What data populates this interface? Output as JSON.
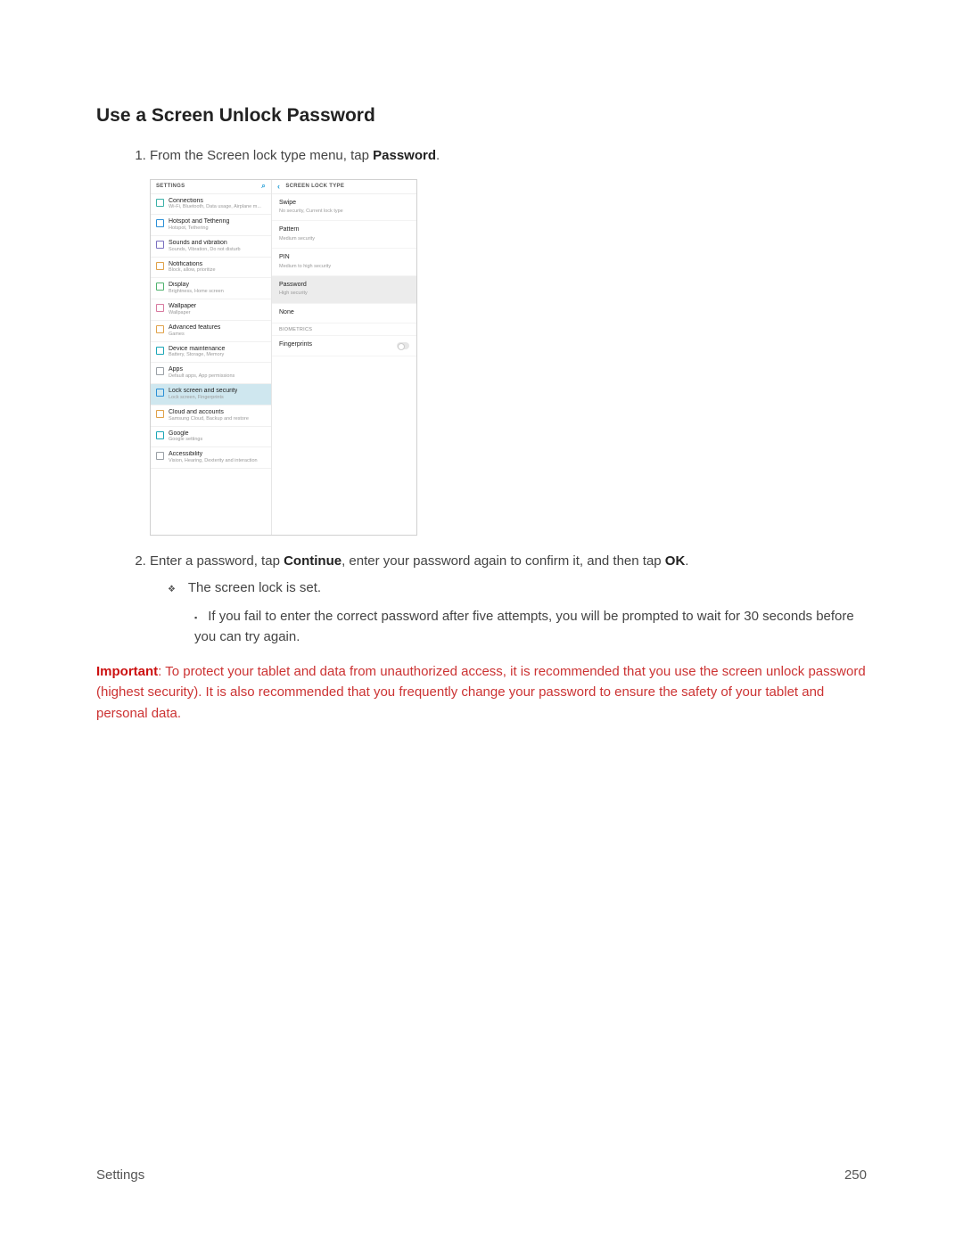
{
  "title": "Use a Screen Unlock Password",
  "steps": {
    "one_prefix": "From the Screen lock type menu, tap ",
    "one_bold": "Password",
    "one_suffix": ".",
    "two_a": "Enter a password, tap ",
    "two_b1": "Continue",
    "two_c": ", enter your password again to confirm it, and then tap ",
    "two_b2": "OK",
    "two_d": "."
  },
  "sub1": "The screen lock is set.",
  "sub2": "If you fail to enter the correct password after five attempts, you will be prompted to wait for 30 seconds before you can try again.",
  "important_label": "Important",
  "important_text": ": To protect your tablet and data from unauthorized access, it is recommended that you use the screen unlock password (highest security). It is also recommended that you frequently change your password to ensure the safety of your tablet and personal data.",
  "footer_left": "Settings",
  "footer_right": "250",
  "screenshot": {
    "left_header": "SETTINGS",
    "right_header": "SCREEN LOCK TYPE",
    "items": [
      {
        "title": "Connections",
        "sub": "Wi-Fi, Bluetooth, Data usage, Airplane m..."
      },
      {
        "title": "Hotspot and Tethering",
        "sub": "Hotspot, Tethering"
      },
      {
        "title": "Sounds and vibration",
        "sub": "Sounds, Vibration, Do not disturb"
      },
      {
        "title": "Notifications",
        "sub": "Block, allow, prioritize"
      },
      {
        "title": "Display",
        "sub": "Brightness, Home screen"
      },
      {
        "title": "Wallpaper",
        "sub": "Wallpaper"
      },
      {
        "title": "Advanced features",
        "sub": "Games"
      },
      {
        "title": "Device maintenance",
        "sub": "Battery, Storage, Memory"
      },
      {
        "title": "Apps",
        "sub": "Default apps, App permissions"
      },
      {
        "title": "Lock screen and security",
        "sub": "Lock screen, Fingerprints"
      },
      {
        "title": "Cloud and accounts",
        "sub": "Samsung Cloud, Backup and restore"
      },
      {
        "title": "Google",
        "sub": "Google settings"
      },
      {
        "title": "Accessibility",
        "sub": "Vision, Hearing, Dexterity and interaction"
      }
    ],
    "options": {
      "swipe_t": "Swipe",
      "swipe_s": "No security, Current lock type",
      "pattern_t": "Pattern",
      "pattern_s": "Medium security",
      "pin_t": "PIN",
      "pin_s": "Medium to high security",
      "password_t": "Password",
      "password_s": "High security",
      "none_t": "None",
      "bio_cat": "BIOMETRICS",
      "fp_t": "Fingerprints"
    }
  }
}
